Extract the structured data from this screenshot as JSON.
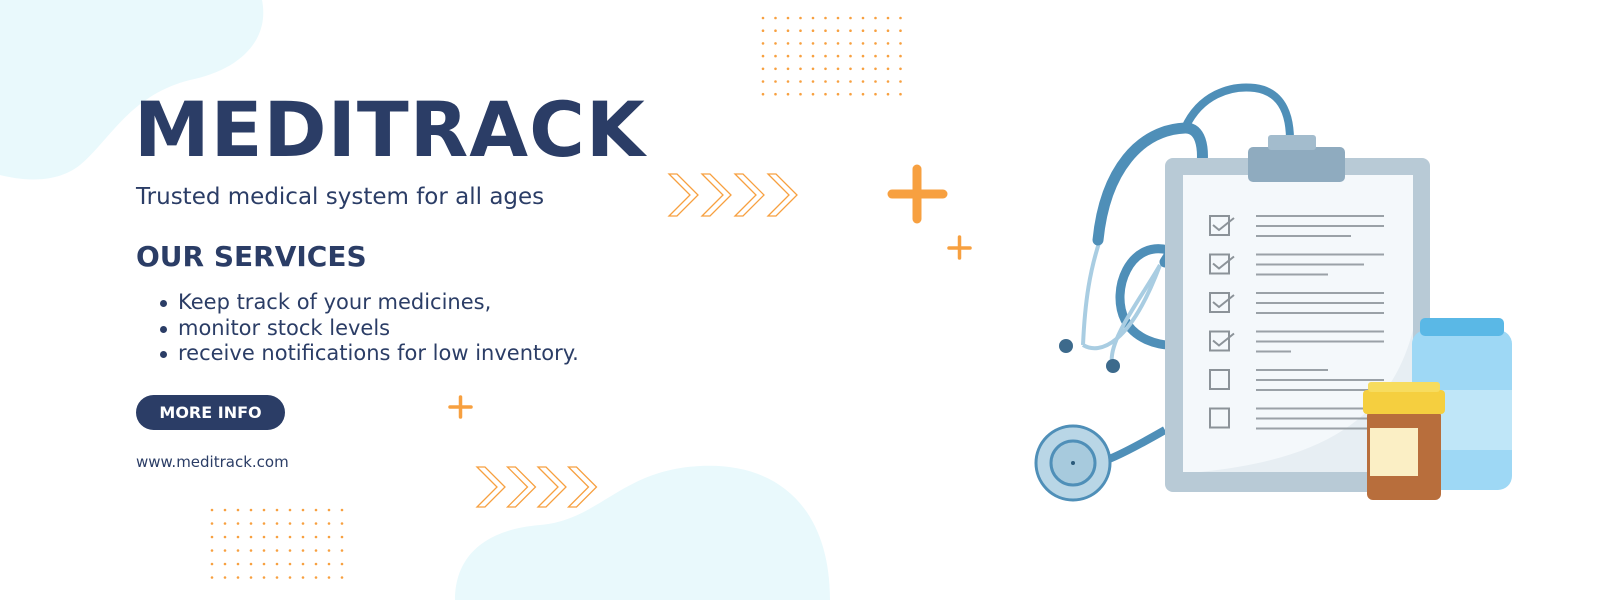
{
  "brand": {
    "title": "MEDITRACK",
    "tagline": "Trusted medical system for all ages"
  },
  "services": {
    "heading": "OUR SERVICES",
    "items": [
      "Keep track of your medicines,",
      "monitor stock levels",
      "receive notifications for low inventory."
    ]
  },
  "cta": {
    "label": "MORE INFO"
  },
  "footer": {
    "url": "www.meditrack.com"
  },
  "colors": {
    "primary": "#2b3d66",
    "accent": "#f7a040",
    "blob": "#e9f9fc",
    "stethoscope": "#4f8fb8"
  },
  "illustration": {
    "icons": [
      "stethoscope-icon",
      "clipboard-checklist-icon",
      "medicine-bottle-icon",
      "pill-jar-icon"
    ],
    "checked_items": 4,
    "total_items": 6
  }
}
